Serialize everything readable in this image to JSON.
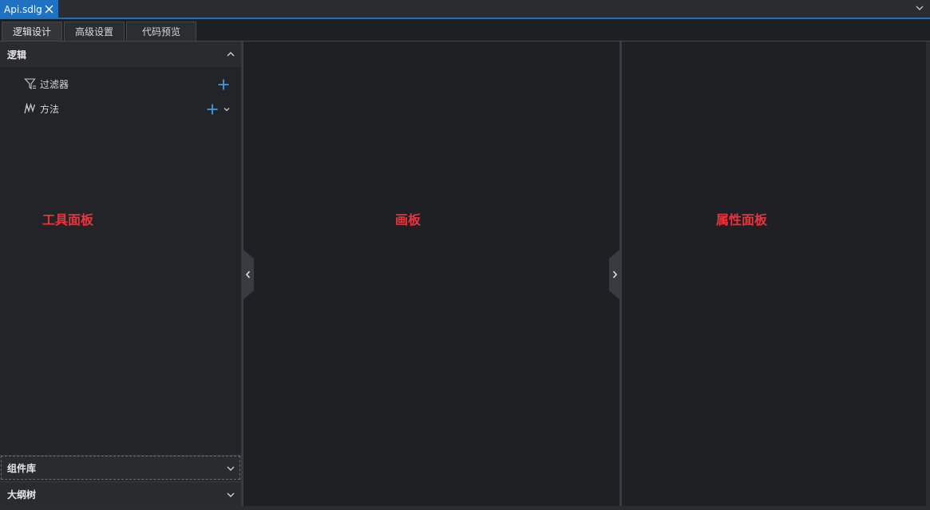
{
  "document_tab": {
    "title": "Api.sdlg"
  },
  "subtabs": [
    {
      "label": "逻辑设计"
    },
    {
      "label": "高级设置"
    },
    {
      "label": "代码预览"
    }
  ],
  "left_panel": {
    "logic_section": {
      "title": "逻辑"
    },
    "items": [
      {
        "label": "过滤器",
        "icon": "filter-icon"
      },
      {
        "label": "方法",
        "icon": "method-icon"
      }
    ],
    "component_library": {
      "title": "组件库"
    },
    "outline_tree": {
      "title": "大纲树"
    },
    "annotation": "工具面板"
  },
  "canvas": {
    "annotation": "画板"
  },
  "property_panel": {
    "annotation": "属性面板"
  },
  "colors": {
    "accent": "#1f72c2",
    "plus": "#3d9be9",
    "annotation": "#e8343c"
  }
}
